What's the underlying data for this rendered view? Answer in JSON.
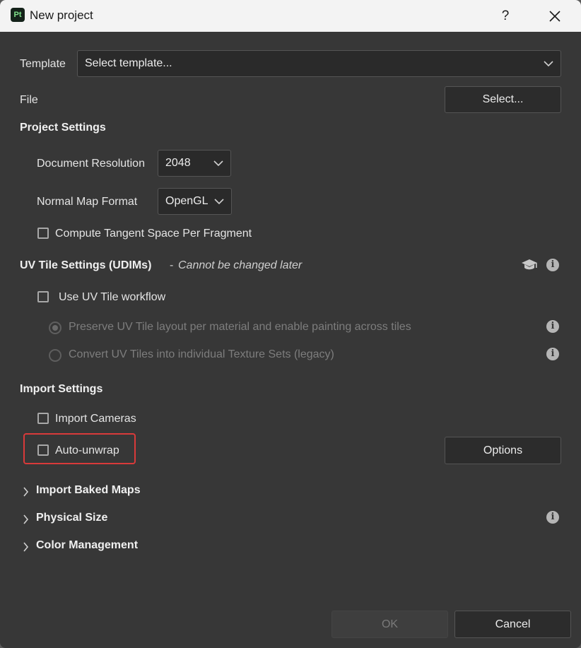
{
  "titlebar": {
    "app_icon_text": "Pt",
    "title": "New project",
    "help": "?"
  },
  "template": {
    "label": "Template",
    "value": "Select template..."
  },
  "file": {
    "label": "File",
    "button": "Select..."
  },
  "project_settings": {
    "heading": "Project Settings",
    "resolution_label": "Document Resolution",
    "resolution_value": "2048",
    "normal_map_label": "Normal Map Format",
    "normal_map_value": "OpenGL",
    "tangent_label": "Compute Tangent Space Per Fragment",
    "tangent_checked": false
  },
  "uv_tile": {
    "heading": "UV Tile Settings (UDIMs)",
    "note_dash": "-",
    "note": "Cannot be changed later",
    "use_label": "Use UV Tile workflow",
    "use_checked": false,
    "option1": "Preserve UV Tile layout per material and enable painting across tiles",
    "option2": "Convert UV Tiles into individual Texture Sets (legacy)",
    "selected_option": "option1"
  },
  "import_settings": {
    "heading": "Import Settings",
    "cameras_label": "Import Cameras",
    "cameras_checked": false,
    "unwrap_label": "Auto-unwrap",
    "unwrap_checked": false,
    "options_button": "Options"
  },
  "sections": {
    "baked_maps": "Import Baked Maps",
    "physical_size": "Physical Size",
    "color_management": "Color Management"
  },
  "footer": {
    "ok": "OK",
    "cancel": "Cancel"
  },
  "colors": {
    "background": "#373737",
    "titlebar": "#f3f3f3",
    "highlight": "#d93a3a",
    "app_icon_text": "#7fe08a"
  }
}
